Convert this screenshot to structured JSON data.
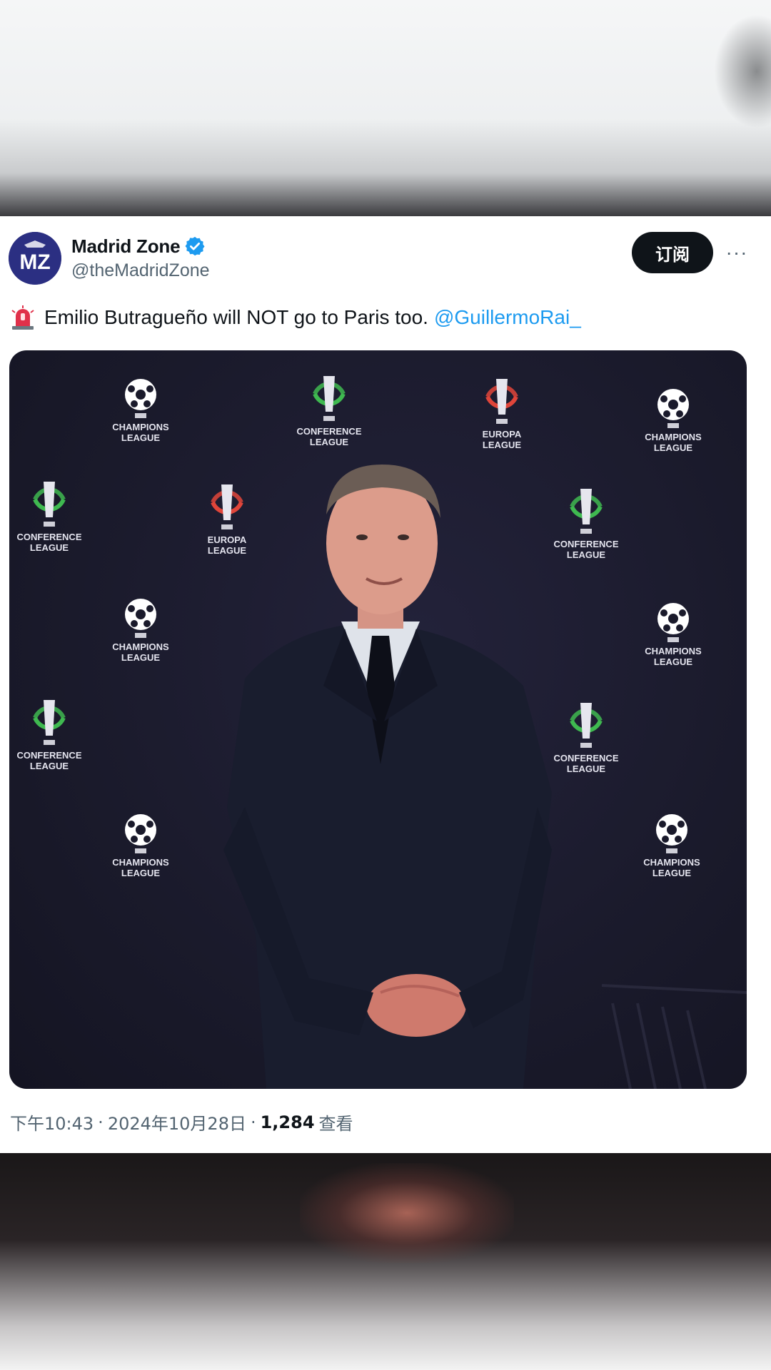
{
  "tweet": {
    "author": {
      "display_name": "Madrid Zone",
      "handle": "@theMadridZone",
      "avatar_text": "MZ",
      "verified": true
    },
    "subscribe_label": "订阅",
    "more_label": "···",
    "text": {
      "emoji": "siren-icon",
      "body": "Emilio Butragueño will NOT go to Paris too.",
      "mention": "@GuillermoRai_"
    },
    "meta": {
      "time": "下午10:43",
      "date": "2024年10月28日",
      "views_count": "1,284",
      "views_label": "查看"
    }
  },
  "photo": {
    "backdrop_logos": [
      {
        "line1": "CHAMPIONS",
        "line2": "LEAGUE"
      },
      {
        "line1": "CONFERENCE",
        "line2": "LEAGUE"
      },
      {
        "line1": "EUROPA",
        "line2": "LEAGUE"
      }
    ]
  },
  "colors": {
    "text_primary": "#0f1419",
    "text_secondary": "#536471",
    "link": "#1d9bf0",
    "button_bg": "#0f1419",
    "avatar_bg": "#2a2e7d",
    "photo_bg": "#1a1a2b"
  }
}
